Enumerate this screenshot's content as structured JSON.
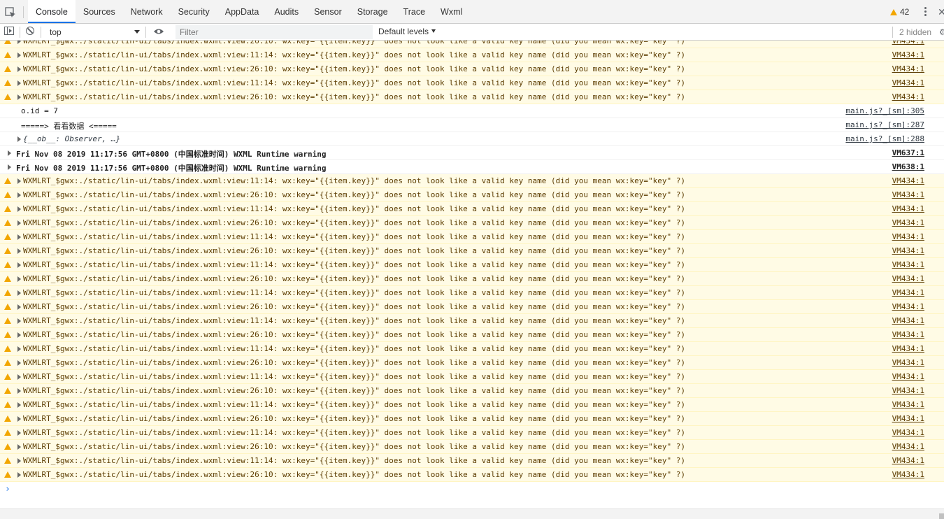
{
  "tabbar": {
    "tabs": [
      "Console",
      "Sources",
      "Network",
      "Security",
      "AppData",
      "Audits",
      "Sensor",
      "Storage",
      "Trace",
      "Wxml"
    ],
    "active": "Console",
    "warning_count": "42"
  },
  "toolbar": {
    "context": "top",
    "filter_placeholder": "Filter",
    "levels": "Default levels",
    "hidden": "2 hidden"
  },
  "colors": {
    "warning_bg": "#fffbe5",
    "warning_icon": "#f2a600",
    "active_tab": "#1a73e8"
  },
  "console": {
    "rows": [
      {
        "type": "warn",
        "text": "WXMLRT_$gwx:./static/lin-ui/tabs/index.wxml:view:26:10: wx:key=\"{{item.key}}\" does not look like a valid key name (did you mean wx:key=\"key\" ?)",
        "src": "VM434:1"
      },
      {
        "type": "warn",
        "text": "WXMLRT_$gwx:./static/lin-ui/tabs/index.wxml:view:11:14: wx:key=\"{{item.key}}\" does not look like a valid key name (did you mean wx:key=\"key\" ?)",
        "src": "VM434:1"
      },
      {
        "type": "warn",
        "text": "WXMLRT_$gwx:./static/lin-ui/tabs/index.wxml:view:26:10: wx:key=\"{{item.key}}\" does not look like a valid key name (did you mean wx:key=\"key\" ?)",
        "src": "VM434:1"
      },
      {
        "type": "warn",
        "text": "WXMLRT_$gwx:./static/lin-ui/tabs/index.wxml:view:11:14: wx:key=\"{{item.key}}\" does not look like a valid key name (did you mean wx:key=\"key\" ?)",
        "src": "VM434:1"
      },
      {
        "type": "warn",
        "text": "WXMLRT_$gwx:./static/lin-ui/tabs/index.wxml:view:26:10: wx:key=\"{{item.key}}\" does not look like a valid key name (did you mean wx:key=\"key\" ?)",
        "src": "VM434:1"
      },
      {
        "type": "plain",
        "text": "o.id = 7",
        "src": "main.js?_[sm]:305"
      },
      {
        "type": "plain",
        "text": "=====> 看看数据 <=====",
        "src": "main.js?_[sm]:287"
      },
      {
        "type": "obj",
        "text": "{__ob__: Observer, …}",
        "src": "main.js?_[sm]:288"
      },
      {
        "type": "bold",
        "text": "Fri Nov 08 2019 11:17:56 GMT+0800 (中国标准时间) WXML Runtime warning",
        "src": "VM637:1"
      },
      {
        "type": "bold",
        "text": "Fri Nov 08 2019 11:17:56 GMT+0800 (中国标准时间) WXML Runtime warning",
        "src": "VM638:1"
      },
      {
        "type": "warn",
        "text": "WXMLRT_$gwx:./static/lin-ui/tabs/index.wxml:view:11:14: wx:key=\"{{item.key}}\" does not look like a valid key name (did you mean wx:key=\"key\" ?)",
        "src": "VM434:1"
      },
      {
        "type": "warn",
        "text": "WXMLRT_$gwx:./static/lin-ui/tabs/index.wxml:view:26:10: wx:key=\"{{item.key}}\" does not look like a valid key name (did you mean wx:key=\"key\" ?)",
        "src": "VM434:1"
      },
      {
        "type": "warn",
        "text": "WXMLRT_$gwx:./static/lin-ui/tabs/index.wxml:view:11:14: wx:key=\"{{item.key}}\" does not look like a valid key name (did you mean wx:key=\"key\" ?)",
        "src": "VM434:1"
      },
      {
        "type": "warn",
        "text": "WXMLRT_$gwx:./static/lin-ui/tabs/index.wxml:view:26:10: wx:key=\"{{item.key}}\" does not look like a valid key name (did you mean wx:key=\"key\" ?)",
        "src": "VM434:1"
      },
      {
        "type": "warn",
        "text": "WXMLRT_$gwx:./static/lin-ui/tabs/index.wxml:view:11:14: wx:key=\"{{item.key}}\" does not look like a valid key name (did you mean wx:key=\"key\" ?)",
        "src": "VM434:1"
      },
      {
        "type": "warn",
        "text": "WXMLRT_$gwx:./static/lin-ui/tabs/index.wxml:view:26:10: wx:key=\"{{item.key}}\" does not look like a valid key name (did you mean wx:key=\"key\" ?)",
        "src": "VM434:1"
      },
      {
        "type": "warn",
        "text": "WXMLRT_$gwx:./static/lin-ui/tabs/index.wxml:view:11:14: wx:key=\"{{item.key}}\" does not look like a valid key name (did you mean wx:key=\"key\" ?)",
        "src": "VM434:1"
      },
      {
        "type": "warn",
        "text": "WXMLRT_$gwx:./static/lin-ui/tabs/index.wxml:view:26:10: wx:key=\"{{item.key}}\" does not look like a valid key name (did you mean wx:key=\"key\" ?)",
        "src": "VM434:1"
      },
      {
        "type": "warn",
        "text": "WXMLRT_$gwx:./static/lin-ui/tabs/index.wxml:view:11:14: wx:key=\"{{item.key}}\" does not look like a valid key name (did you mean wx:key=\"key\" ?)",
        "src": "VM434:1"
      },
      {
        "type": "warn",
        "text": "WXMLRT_$gwx:./static/lin-ui/tabs/index.wxml:view:26:10: wx:key=\"{{item.key}}\" does not look like a valid key name (did you mean wx:key=\"key\" ?)",
        "src": "VM434:1"
      },
      {
        "type": "warn",
        "text": "WXMLRT_$gwx:./static/lin-ui/tabs/index.wxml:view:11:14: wx:key=\"{{item.key}}\" does not look like a valid key name (did you mean wx:key=\"key\" ?)",
        "src": "VM434:1"
      },
      {
        "type": "warn",
        "text": "WXMLRT_$gwx:./static/lin-ui/tabs/index.wxml:view:26:10: wx:key=\"{{item.key}}\" does not look like a valid key name (did you mean wx:key=\"key\" ?)",
        "src": "VM434:1"
      },
      {
        "type": "warn",
        "text": "WXMLRT_$gwx:./static/lin-ui/tabs/index.wxml:view:11:14: wx:key=\"{{item.key}}\" does not look like a valid key name (did you mean wx:key=\"key\" ?)",
        "src": "VM434:1"
      },
      {
        "type": "warn",
        "text": "WXMLRT_$gwx:./static/lin-ui/tabs/index.wxml:view:26:10: wx:key=\"{{item.key}}\" does not look like a valid key name (did you mean wx:key=\"key\" ?)",
        "src": "VM434:1"
      },
      {
        "type": "warn",
        "text": "WXMLRT_$gwx:./static/lin-ui/tabs/index.wxml:view:11:14: wx:key=\"{{item.key}}\" does not look like a valid key name (did you mean wx:key=\"key\" ?)",
        "src": "VM434:1"
      },
      {
        "type": "warn",
        "text": "WXMLRT_$gwx:./static/lin-ui/tabs/index.wxml:view:26:10: wx:key=\"{{item.key}}\" does not look like a valid key name (did you mean wx:key=\"key\" ?)",
        "src": "VM434:1"
      },
      {
        "type": "warn",
        "text": "WXMLRT_$gwx:./static/lin-ui/tabs/index.wxml:view:11:14: wx:key=\"{{item.key}}\" does not look like a valid key name (did you mean wx:key=\"key\" ?)",
        "src": "VM434:1"
      },
      {
        "type": "warn",
        "text": "WXMLRT_$gwx:./static/lin-ui/tabs/index.wxml:view:26:10: wx:key=\"{{item.key}}\" does not look like a valid key name (did you mean wx:key=\"key\" ?)",
        "src": "VM434:1"
      },
      {
        "type": "warn",
        "text": "WXMLRT_$gwx:./static/lin-ui/tabs/index.wxml:view:11:14: wx:key=\"{{item.key}}\" does not look like a valid key name (did you mean wx:key=\"key\" ?)",
        "src": "VM434:1"
      },
      {
        "type": "warn",
        "text": "WXMLRT_$gwx:./static/lin-ui/tabs/index.wxml:view:26:10: wx:key=\"{{item.key}}\" does not look like a valid key name (did you mean wx:key=\"key\" ?)",
        "src": "VM434:1"
      },
      {
        "type": "warn",
        "text": "WXMLRT_$gwx:./static/lin-ui/tabs/index.wxml:view:11:14: wx:key=\"{{item.key}}\" does not look like a valid key name (did you mean wx:key=\"key\" ?)",
        "src": "VM434:1"
      },
      {
        "type": "warn",
        "text": "WXMLRT_$gwx:./static/lin-ui/tabs/index.wxml:view:26:10: wx:key=\"{{item.key}}\" does not look like a valid key name (did you mean wx:key=\"key\" ?)",
        "src": "VM434:1"
      }
    ],
    "prompt": "›"
  }
}
